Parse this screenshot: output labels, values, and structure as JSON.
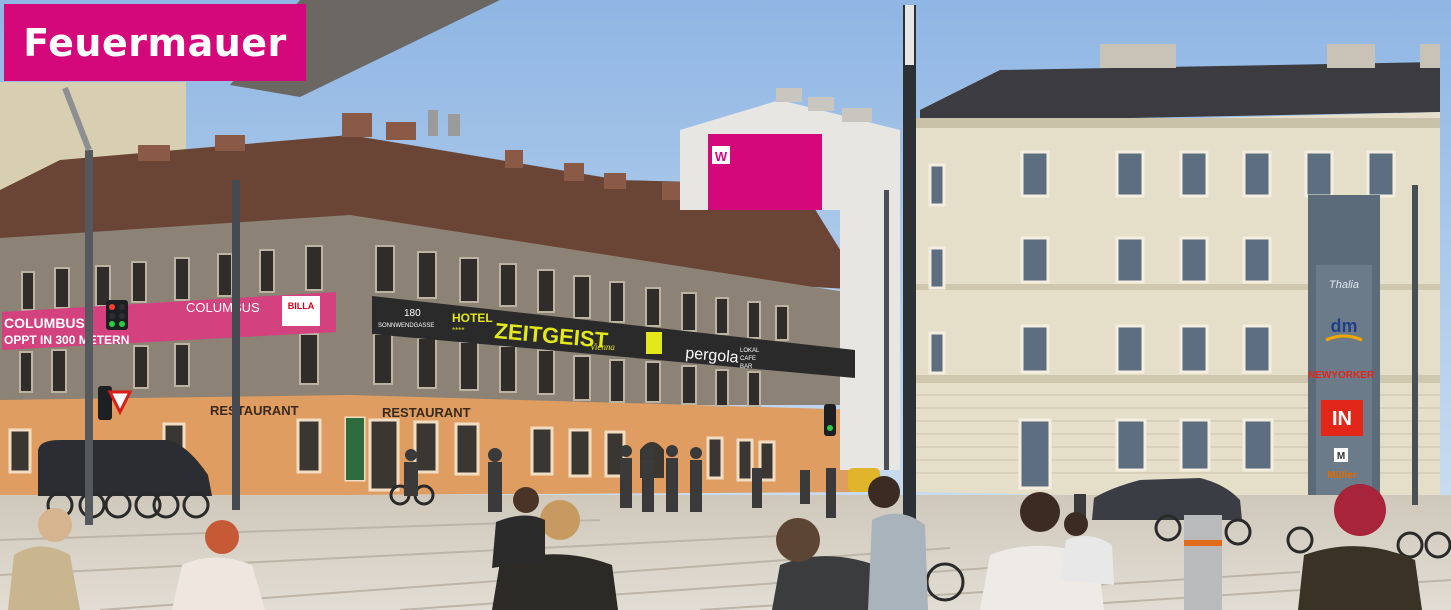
{
  "title": "Feuermauer",
  "colors": {
    "brand_magenta": "#d4087a",
    "sky": "#aac8ea",
    "left_building": "#8b8174",
    "ground_floor_orange": "#e0a064",
    "right_building": "#e6e0cc",
    "roof": "#5b3e33",
    "plaza": "#d9d3c8"
  },
  "signs": {
    "columbus_banner": "COLUMBUS",
    "columbus_sub": "OPPT IN 300 METERN",
    "columbus_small": "COLUMBUS",
    "billa": "BILLA",
    "hotel_address_num": "180",
    "hotel_address_street": "SONNWENDGASSE",
    "hotel_word": "HOTEL",
    "hotel_stars": "****",
    "hotel_name": "ZEITGEIST",
    "hotel_city": "Vienna",
    "pergola": "pergola",
    "lokal": "LOKAL",
    "cafe": "CAFE",
    "bar": "BAR",
    "restaurant_left": "RESTAURANT",
    "restaurant_right": "RESTAURANT",
    "billboard_logo": "W"
  },
  "totem": {
    "brands": [
      "Thalia",
      "dm",
      "NEWYORKER",
      "IN",
      "M",
      "Müller"
    ]
  },
  "icons": [
    "traffic-light-icon",
    "street-lamp-icon",
    "yield-sign-icon",
    "bicycle-icon"
  ]
}
